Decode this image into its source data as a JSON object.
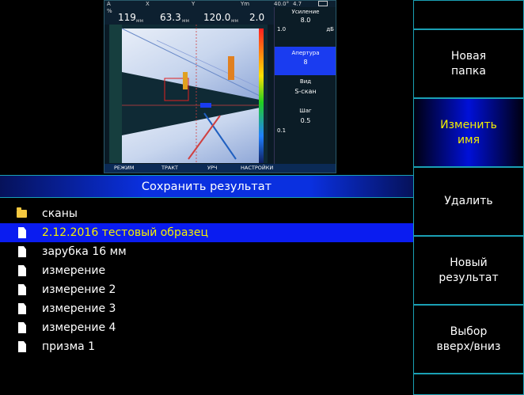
{
  "preview": {
    "label_a": "А",
    "label_a_sub": "%",
    "value_a": "119",
    "unit_a": "мм",
    "label_x": "X",
    "value_x": "63.3",
    "unit_x": "мм",
    "label_y": "Y",
    "value_y": "120.0",
    "unit_y": "мм",
    "label_ym": "Ym",
    "value_ym": "2.0",
    "angle": "40.0°",
    "freq": "4.7",
    "side": {
      "gain_label": "Усиление",
      "gain_value": "8.0",
      "gain_min": "1.0",
      "gain_unit": "дБ",
      "aperture_label": "Апертура",
      "aperture_value": "8",
      "view_label": "Вид",
      "view_value": "S-скан",
      "step_label": "Шаг",
      "step_value": "0.5",
      "step_min": "0.1"
    },
    "footer": [
      "РЕЖИМ",
      "ТРАКТ",
      "УРЧ",
      "НАСТРОЙКИ"
    ],
    "colors": {
      "background": "#0a1a25",
      "selected": "#1a3cf0",
      "footer": "#0b2a55"
    }
  },
  "dialog": {
    "title": "Сохранить результат"
  },
  "files": [
    {
      "name": "сканы",
      "type": "folder",
      "selected": false
    },
    {
      "name": "2.12.2016 тестовый образец",
      "type": "file",
      "selected": true
    },
    {
      "name": "зарубка 16 мм",
      "type": "file",
      "selected": false
    },
    {
      "name": "измерение",
      "type": "file",
      "selected": false
    },
    {
      "name": "измерение 2",
      "type": "file",
      "selected": false
    },
    {
      "name": "измерение 3",
      "type": "file",
      "selected": false
    },
    {
      "name": "измерение 4",
      "type": "file",
      "selected": false
    },
    {
      "name": "призма 1",
      "type": "file",
      "selected": false
    }
  ],
  "menu": {
    "new_folder": "Новая\nпапка",
    "rename": "Изменить\nимя",
    "delete": "Удалить",
    "new_result": "Новый\nрезультат",
    "select_updown": "Выбор\nвверх/вниз"
  },
  "colors": {
    "accent_blue": "#0a30e0",
    "highlight_text": "#f5f000",
    "border": "#1aa0b4",
    "folder": "#f5c840"
  }
}
